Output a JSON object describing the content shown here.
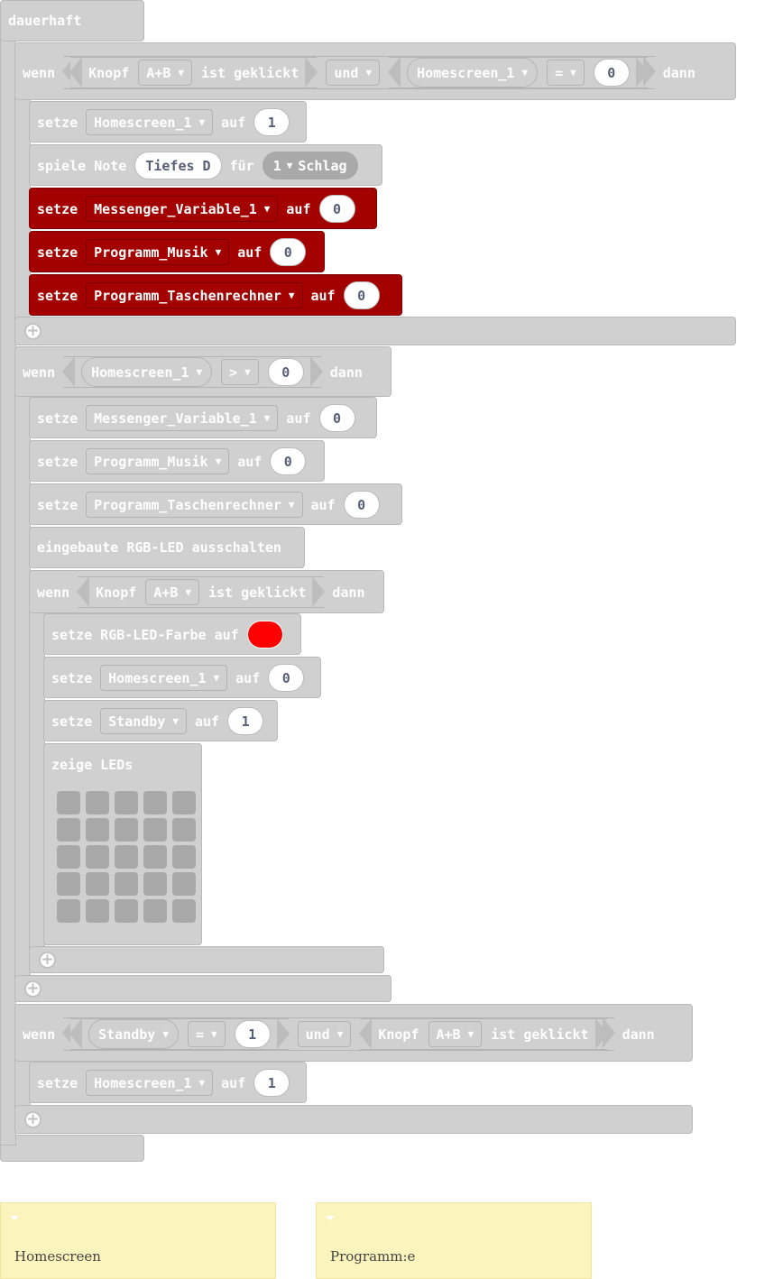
{
  "loop": {
    "label": "dauerhaft"
  },
  "kw": {
    "wenn": "wenn",
    "dann": "dann",
    "und": "und",
    "setze": "setze",
    "auf": "auf",
    "spiele_note": "spiele Note",
    "fuer": "für",
    "knopf": "Knopf",
    "ist_geklickt": "ist geklickt",
    "rgb_off": "eingebaute RGB-LED ausschalten",
    "rgb_color": "setze RGB-LED-Farbe auf",
    "show_leds": "zeige LEDs"
  },
  "if1": {
    "button": "A+B",
    "logic": "und",
    "var": "Homescreen_1",
    "op": "=",
    "value": "0",
    "stmts": [
      {
        "var": "Homescreen_1",
        "value": "1"
      },
      {
        "note": "Tiefes D",
        "beats": "1",
        "beat_unit": "Schlag"
      },
      {
        "var": "Messenger_Variable_1",
        "value": "0"
      },
      {
        "var": "Programm_Musik",
        "value": "0"
      },
      {
        "var": "Programm_Taschenrechner",
        "value": "0"
      }
    ]
  },
  "if2": {
    "var": "Homescreen_1",
    "op": ">",
    "value": "0",
    "stmts": [
      {
        "var": "Messenger_Variable_1",
        "value": "0"
      },
      {
        "var": "Programm_Musik",
        "value": "0"
      },
      {
        "var": "Programm_Taschenrechner",
        "value": "0"
      }
    ],
    "inner_if": {
      "button": "A+B",
      "color_hex": "#ff0000",
      "stmts": [
        {
          "var": "Homescreen_1",
          "value": "0"
        },
        {
          "var": "Standby",
          "value": "1"
        }
      ]
    }
  },
  "if3": {
    "var": "Standby",
    "op": "=",
    "value": "1",
    "logic": "und",
    "button": "A+B",
    "stmts": [
      {
        "var": "Homescreen_1",
        "value": "1"
      }
    ]
  },
  "comments": [
    {
      "text": "Homescreen"
    },
    {
      "text": "Programm:e"
    }
  ],
  "colors": {
    "block_grey": "#d0d0d0",
    "variable_red": "#a30000",
    "comment_yellow": "#fbf4bd",
    "led_color": "#ff0000"
  }
}
